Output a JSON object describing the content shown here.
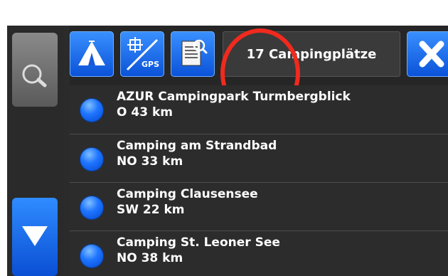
{
  "toolbar": {
    "count_label": "17 Campingplätze",
    "gps_label": "GPS"
  },
  "sidebar": {
    "items": [
      {
        "icon": "search-icon"
      },
      {
        "icon": "list-icon"
      },
      {
        "icon": "arrow-down-icon"
      }
    ]
  },
  "list": {
    "items": [
      {
        "name": "AZUR Campingpark Turmbergblick",
        "distance": "O 43 km"
      },
      {
        "name": "Camping am Strandbad",
        "distance": "NO 33 km"
      },
      {
        "name": "Camping Clausensee",
        "distance": "SW 22 km"
      },
      {
        "name": "Camping St. Leoner See",
        "distance": "NO 38 km"
      }
    ]
  },
  "colors": {
    "accent": "#1f75ff",
    "highlight_ring": "#f02a1e"
  }
}
